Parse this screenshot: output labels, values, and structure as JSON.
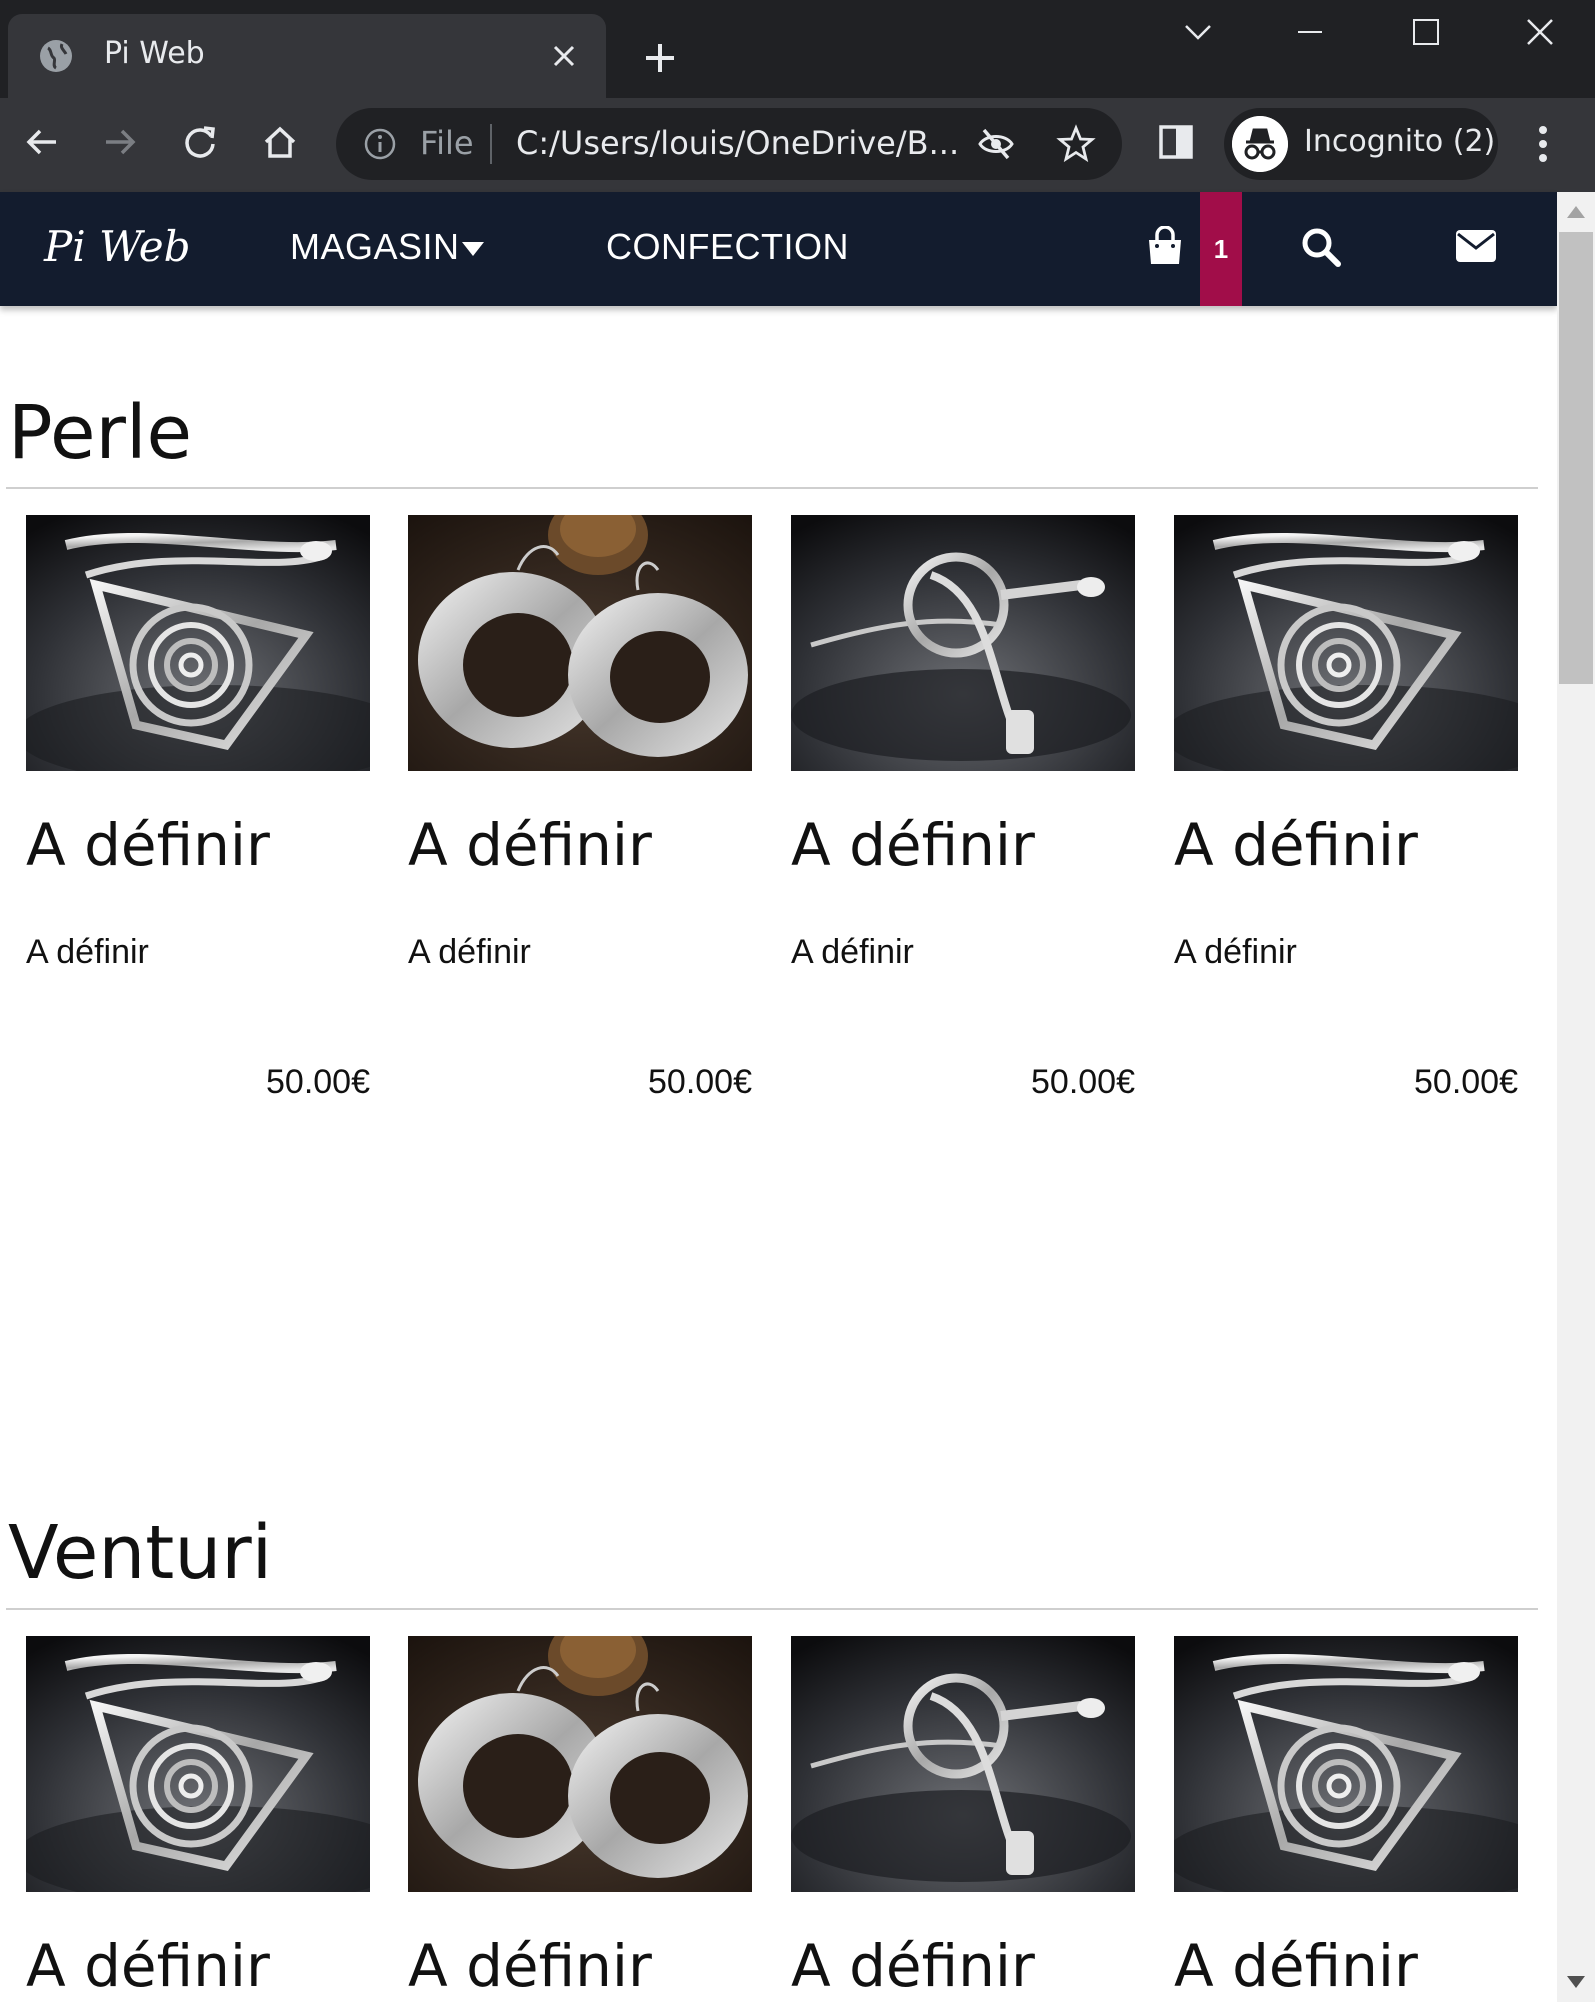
{
  "browser": {
    "tab_title": "Pi Web",
    "omnibox": {
      "scheme_label": "File",
      "url": "C:/Users/louis/OneDrive/B..."
    },
    "profile_label": "Incognito (2)"
  },
  "nav": {
    "brand": "Pi Web",
    "magasin": "MAGASIN",
    "confection": "CONFECTION",
    "cart_count": "1",
    "colors": {
      "bar": "#131c2e",
      "badge": "#a10d49"
    }
  },
  "sections": [
    {
      "title": "Perle",
      "products": [
        {
          "image": "spiral-bracelet-photo",
          "title": "A définir",
          "description": "A définir",
          "price": "50.00€"
        },
        {
          "image": "hammered-hoop-earrings-photo",
          "title": "A définir",
          "description": "A définir",
          "price": "50.00€"
        },
        {
          "image": "knot-bangle-photo",
          "title": "A définir",
          "description": "A définir",
          "price": "50.00€"
        },
        {
          "image": "spiral-bracelet-photo",
          "title": "A définir",
          "description": "A définir",
          "price": "50.00€"
        }
      ]
    },
    {
      "title": "Venturi",
      "products": [
        {
          "image": "spiral-bracelet-photo",
          "title": "A définir"
        },
        {
          "image": "hammered-hoop-earrings-photo",
          "title": "A définir"
        },
        {
          "image": "knot-bangle-photo",
          "title": "A définir"
        },
        {
          "image": "spiral-bracelet-photo",
          "title": "A définir"
        }
      ]
    }
  ]
}
